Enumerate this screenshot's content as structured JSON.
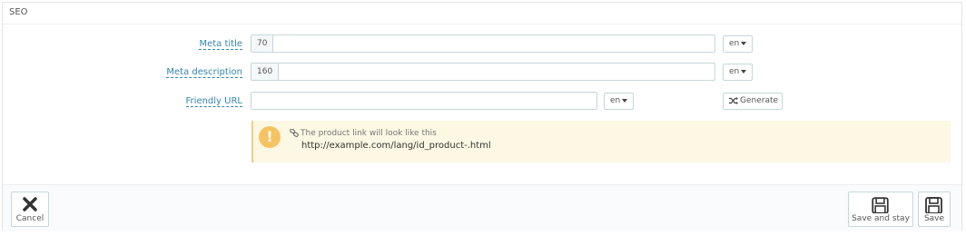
{
  "panel": {
    "title": "SEO"
  },
  "form": {
    "meta_title": {
      "label": "Meta title",
      "counter": "70",
      "value": "",
      "lang": "en"
    },
    "meta_description": {
      "label": "Meta description",
      "counter": "160",
      "value": "",
      "lang": "en"
    },
    "friendly_url": {
      "label": "Friendly URL",
      "value": "",
      "lang": "en",
      "generate_label": "Generate"
    }
  },
  "alert": {
    "line1": "The product link will look like this",
    "line2": "http://example.com/lang/id_product-.html",
    "icon": "exclamation-icon",
    "link_icon": "link-icon"
  },
  "footer": {
    "cancel_label": "Cancel",
    "save_and_stay_label": "Save and stay",
    "save_label": "Save"
  },
  "colors": {
    "label_blue": "#3586ae",
    "alert_bg": "#fcf8e3",
    "alert_icon": "#f6c363",
    "border": "#c7d6db"
  }
}
